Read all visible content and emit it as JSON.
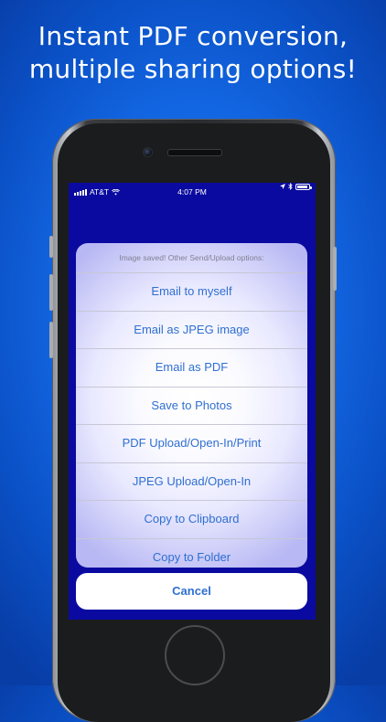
{
  "headline": {
    "line1": "Instant PDF conversion,",
    "line2": "multiple sharing options!"
  },
  "status_bar": {
    "carrier": "AT&T",
    "time": "4:07 PM",
    "icons": [
      "signal-icon",
      "wifi-icon",
      "location-arrow-icon",
      "bluetooth-icon",
      "battery-icon"
    ]
  },
  "action_sheet": {
    "message": "Image saved!  Other Send/Upload options:",
    "items": [
      "Email to myself",
      "Email as JPEG image",
      "Email as PDF",
      "Save to Photos",
      "PDF Upload/Open-In/Print",
      "JPEG Upload/Open-In",
      "Copy to Clipboard",
      "Copy to Folder"
    ],
    "cancel_label": "Cancel"
  },
  "colors": {
    "background": "#1366e2",
    "screen": "#0a0aa0",
    "action_text": "#2f6fd0"
  }
}
